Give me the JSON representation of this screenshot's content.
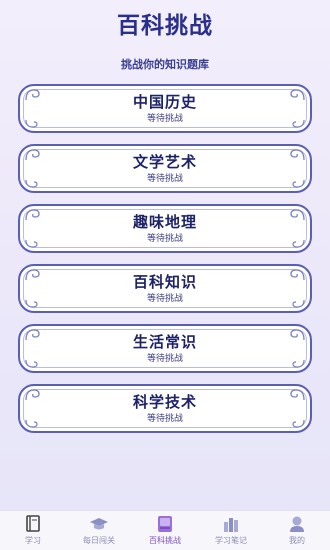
{
  "header": {
    "title": "百科挑战",
    "subtitle": "挑战你的知识题库"
  },
  "categories": [
    {
      "name": "中国历史",
      "status": "等待挑战"
    },
    {
      "name": "文学艺术",
      "status": "等待挑战"
    },
    {
      "name": "趣味地理",
      "status": "等待挑战"
    },
    {
      "name": "百科知识",
      "status": "等待挑战"
    },
    {
      "name": "生活常识",
      "status": "等待挑战"
    },
    {
      "name": "科学技术",
      "status": "等待挑战"
    }
  ],
  "tabbar": {
    "active_index": 2,
    "items": [
      {
        "label": "学习",
        "icon": "book-icon"
      },
      {
        "label": "每日闯关",
        "icon": "graduation-cap-icon"
      },
      {
        "label": "百科挑战",
        "icon": "encyclopedia-icon"
      },
      {
        "label": "学习笔记",
        "icon": "bar-chart-icon"
      },
      {
        "label": "我的",
        "icon": "user-icon"
      }
    ]
  },
  "colors": {
    "title": "#2a2f8c",
    "card_border": "#5a5fb0",
    "tab_active": "#7b4fc6",
    "tab_inactive": "#8d8db5"
  }
}
